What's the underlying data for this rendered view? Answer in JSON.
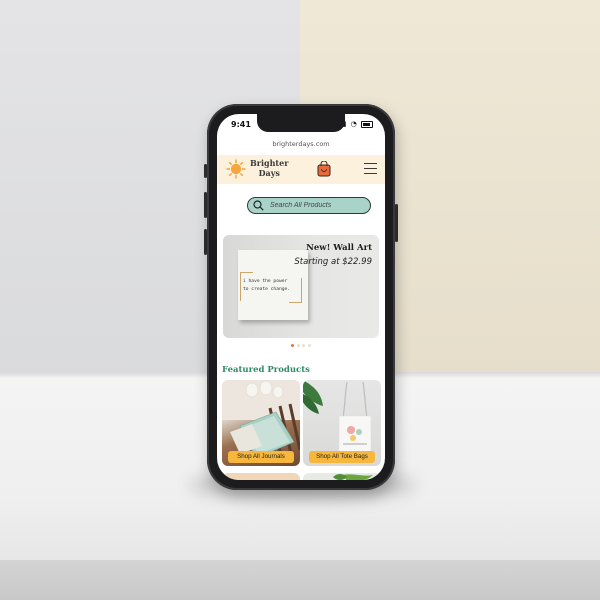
{
  "status_bar": {
    "time": "9:41"
  },
  "browser": {
    "url": "brighterdays.com"
  },
  "header": {
    "brand_line1": "Brighter",
    "brand_line2": "Days"
  },
  "search": {
    "placeholder": "Search All Products"
  },
  "banner": {
    "title": "New! Wall Art",
    "subtitle": "Starting at $22.99",
    "art_line1": "i have the power",
    "art_line2": "to create change."
  },
  "carousel": {
    "total": 4,
    "active": 1
  },
  "featured": {
    "heading": "Featured Products",
    "cards": [
      {
        "button": "Shop All Journals"
      },
      {
        "button": "Shop All Tote Bags"
      }
    ]
  },
  "colors": {
    "header_bg": "#fbf1dc",
    "search_bg": "#a9d3c9",
    "accent_green": "#2f8a67",
    "button_yellow": "#f6b73c",
    "dot_active": "#e07a3d"
  }
}
